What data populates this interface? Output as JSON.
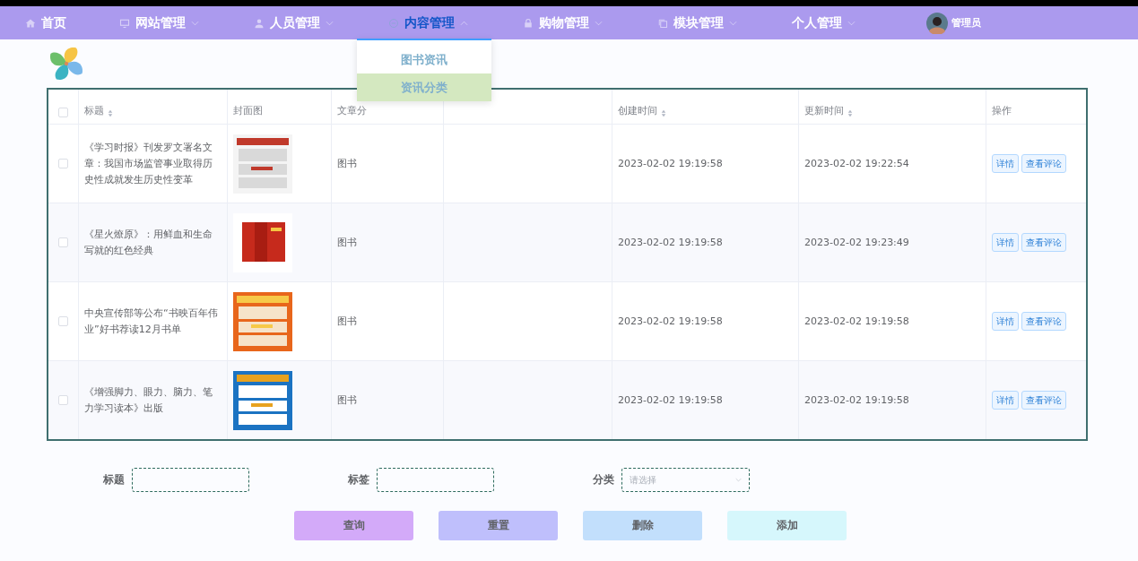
{
  "nav": {
    "items": [
      {
        "label": "首页",
        "has_caret": false,
        "selected": false
      },
      {
        "label": "网站管理",
        "has_caret": true,
        "selected": false
      },
      {
        "label": "人员管理",
        "has_caret": true,
        "selected": false
      },
      {
        "label": "内容管理",
        "has_caret": true,
        "selected": true
      },
      {
        "label": "购物管理",
        "has_caret": true,
        "selected": false
      },
      {
        "label": "模块管理",
        "has_caret": true,
        "selected": false
      },
      {
        "label": "个人管理",
        "has_caret": true,
        "selected": false
      }
    ],
    "user": {
      "name": "管理员"
    }
  },
  "dropdown": {
    "items": [
      {
        "label": "图书资讯",
        "selected": false
      },
      {
        "label": "资讯分类",
        "selected": true
      }
    ]
  },
  "table": {
    "all_checked": false,
    "columns": [
      {
        "label": "标题",
        "sortable": true
      },
      {
        "label": "封面图",
        "sortable": false
      },
      {
        "label": "文章分",
        "sortable": false
      },
      {
        "label": "创建时间",
        "sortable": true
      },
      {
        "label": "更新时间",
        "sortable": true
      },
      {
        "label": "操作",
        "sortable": false
      }
    ],
    "rows": [
      {
        "checked": false,
        "title": "《学习时报》刊发罗文署名文章：我国市场监管事业取得历史性成就发生历史性变革",
        "cover": {
          "kind": "picture"
        },
        "category": "图书",
        "created": "2023-02-02 19:19:58",
        "updated": "2023-02-02 19:22:54",
        "actions": [
          "详情",
          "查看评论"
        ]
      },
      {
        "checked": false,
        "title": "《星火燎原》：用鲜血和生命写就的红色经典",
        "cover": {
          "kind": "picture"
        },
        "category": "图书",
        "created": "2023-02-02 19:19:58",
        "updated": "2023-02-02 19:23:49",
        "actions": [
          "详情",
          "查看评论"
        ]
      },
      {
        "checked": false,
        "title": "中央宣传部等公布“书映百年伟业”好书荐读12月书单",
        "cover": {
          "kind": "picture"
        },
        "category": "图书",
        "created": "2023-02-02 19:19:58",
        "updated": "2023-02-02 19:19:58",
        "actions": [
          "详情",
          "查看评论"
        ]
      },
      {
        "checked": false,
        "title": "《增强脚力、眼力、脑力、笔力学习读本》出版",
        "cover": {
          "kind": "picture"
        },
        "category": "图书",
        "created": "2023-02-02 19:19:58",
        "updated": "2023-02-02 19:19:58",
        "actions": [
          "详情",
          "查看评论"
        ]
      }
    ]
  },
  "search": {
    "fields": [
      {
        "label": "标题",
        "kind": "text"
      },
      {
        "label": "标签",
        "kind": "text"
      },
      {
        "label": "分类",
        "kind": "select",
        "placeholder": "请选择"
      }
    ],
    "buttons": [
      {
        "label": "查询",
        "color": "#d3aaf9"
      },
      {
        "label": "重置",
        "color": "#bfbffc"
      },
      {
        "label": "删除",
        "color": "#c2dffc"
      },
      {
        "label": "添加",
        "color": "#d6f7fc"
      }
    ]
  }
}
